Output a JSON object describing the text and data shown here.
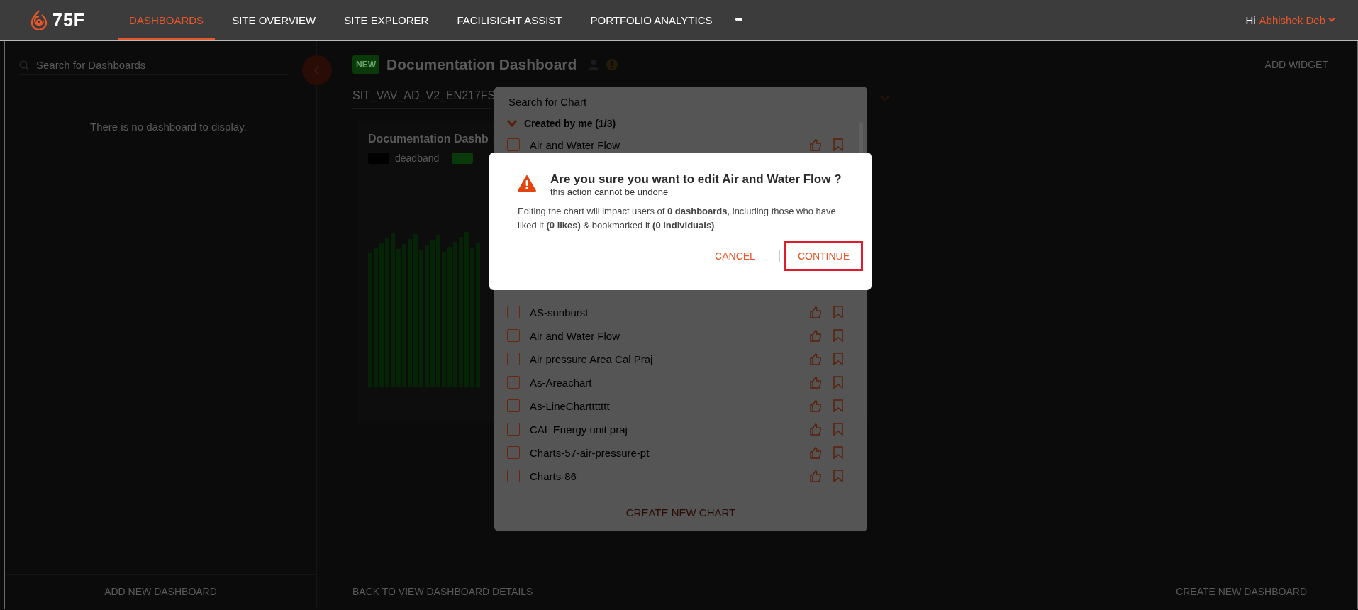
{
  "nav": {
    "logo": "75F",
    "tabs": [
      {
        "label": "DASHBOARDS",
        "selected": true
      },
      {
        "label": "SITE OVERVIEW",
        "selected": false
      },
      {
        "label": "SITE EXPLORER",
        "selected": false
      },
      {
        "label": "FACILISIGHT ASSIST",
        "selected": false
      },
      {
        "label": "PORTFOLIO ANALYTICS",
        "selected": false
      }
    ],
    "more": "•••",
    "greeting": "Hi",
    "user": "Abhishek Deb"
  },
  "sidebar": {
    "search_placeholder": "Search for Dashboards",
    "empty_message": "There is no dashboard to display.",
    "footer_button": "ADD NEW DASHBOARD"
  },
  "dashboard": {
    "badge": "NEW",
    "title": "Documentation Dashboard",
    "add_widget": "ADD WIDGET",
    "site": "SIT_VAV_AD_V2_EN217FS",
    "card": {
      "title": "Documentation Dashb",
      "legend": [
        {
          "label": "deadband",
          "color": "#000000"
        },
        {
          "color": "#0a3a0a"
        }
      ]
    },
    "footer_left": "BACK TO VIEW DASHBOARD DETAILS",
    "footer_right": "CREATE NEW DASHBOARD"
  },
  "chart_picker": {
    "search_placeholder": "Search for Chart",
    "group": {
      "label": "Created by me (1/3)",
      "expanded": true
    },
    "top_items": [
      {
        "label": "Air and Water Flow",
        "checked": false,
        "liked": false,
        "bookmarked": false
      }
    ],
    "items": [
      {
        "label": "AS-sunburst",
        "checked": false,
        "liked": false,
        "bookmarked": false
      },
      {
        "label": "Air and Water Flow",
        "checked": false,
        "liked": false,
        "bookmarked": false
      },
      {
        "label": "Air pressure Area Cal Praj",
        "checked": false,
        "liked": false,
        "bookmarked": false
      },
      {
        "label": "As-Areachart",
        "checked": false,
        "liked": false,
        "bookmarked": false
      },
      {
        "label": "As-LineCharttttttt",
        "checked": false,
        "liked": false,
        "bookmarked": false
      },
      {
        "label": "CAL Energy unit praj",
        "checked": false,
        "liked": false,
        "bookmarked": false
      },
      {
        "label": "Charts-57-air-pressure-pt",
        "checked": false,
        "liked": false,
        "bookmarked": false
      },
      {
        "label": "Charts-86",
        "checked": false,
        "liked": false,
        "bookmarked": false
      }
    ],
    "create_button": "CREATE NEW CHART"
  },
  "dialog": {
    "title": "Are you sure you want to edit Air and Water Flow ?",
    "subtitle": "this action cannot be undone",
    "message": "Editing the chart will impact users of **0 dashboards**, including those who have liked it **(0 likes)** & bookmarked it **(0 individuals)**.",
    "buttons": [
      {
        "label": "CANCEL",
        "highlighted": false
      },
      {
        "label": "CONTINUE",
        "highlighted": true
      }
    ]
  }
}
